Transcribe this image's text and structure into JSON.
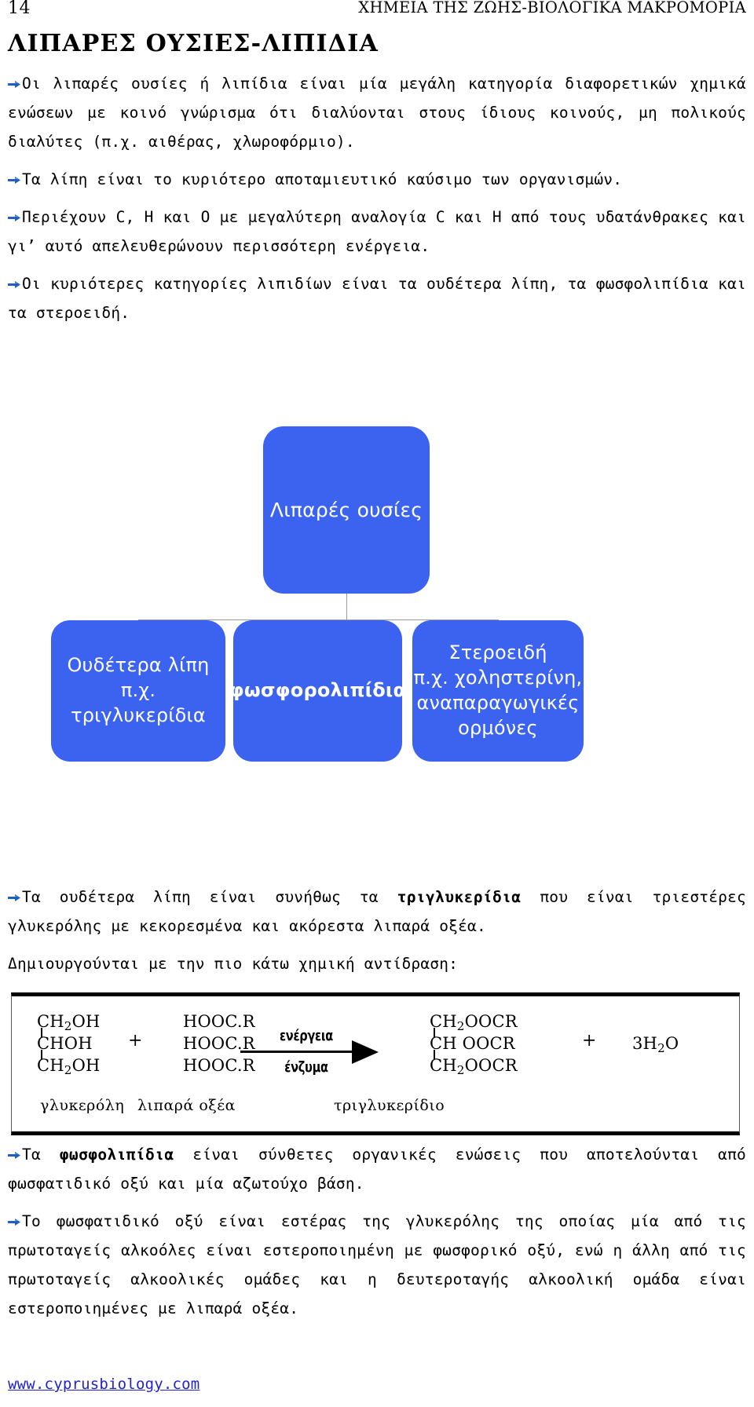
{
  "header": {
    "page_number": "14",
    "running_title": "ΧΗΜΕΙΑ ΤΗΣ ΖΩΗΣ-ΒΙΟΛΟΓΙΚΑ ΜΑΚΡΟΜΟΡΙΑ"
  },
  "title": "ΛΙΠΑΡΕΣ ΟΥΣΙΕΣ-ΛΙΠΙΔΙΑ",
  "bullets_top": [
    {
      "text": "Οι λιπαρές ουσίες ή λιπίδια είναι μία μεγάλη κατηγορία διαφορετικών χημικά ενώσεων με κοινό γνώρισμα ότι διαλύονται στους ίδιους κοινούς, μη πολικούς διαλύτες (π.χ. αιθέρας, χλωροφόρμιο)."
    },
    {
      "text": "Τα λίπη είναι το κυριότερο αποταμιευτικό καύσιμο των οργανισμών."
    },
    {
      "text": "Περιέχουν C, Η και Ο με μεγαλύτερη αναλογία C και Η από τους υδατάνθρακες και γι’ αυτό απελευθερώνουν περισσότερη ενέργεια."
    },
    {
      "text": "Οι κυριότερες κατηγορίες λιπιδίων είναι τα ουδέτερα λίπη, τα φωσφολιπίδια και τα στεροειδή."
    }
  ],
  "flowchart": {
    "accent_color": "#3b63f0",
    "connector_color": "#9a9a9a",
    "root": {
      "label": "Λιπαρές ουσίες"
    },
    "children": [
      {
        "label_line1": "Ουδέτερα λίπη",
        "label_line2": "π.χ. τριγλυκερίδια"
      },
      {
        "label_line1": "φωσφορολιπίδια"
      },
      {
        "label_line1": "Στεροειδή",
        "label_line2": "π.χ. χοληστερίνη,",
        "label_line3": "αναπαραγωγικές",
        "label_line4": "ορμόνες"
      }
    ]
  },
  "bullets_mid": [
    {
      "pre": "Τα ουδέτερα λίπη είναι συνήθως τα ",
      "bold": "τριγλυκερίδια",
      "post": " που είναι τριεστέρες γλυκερόλης με κεκορεσμένα και ακόρεστα λιπαρά οξέα."
    }
  ],
  "intro_reaction": "Δημιουργούνται με την πιο κάτω χημική αντίδραση:",
  "reaction": {
    "reactant1": {
      "line1": "CH",
      "line1_sub": "2",
      "line1_rest": "OH",
      "line2": "CHOH",
      "line3": "CH",
      "line3_sub": "2",
      "line3_rest": "OH",
      "caption": "γλυκερόλη"
    },
    "plus1": "+",
    "reactant2": {
      "line1": "HOOC.R",
      "line2": "HOOC.R",
      "line3": "HOOC.R",
      "caption": "λιπαρά οξέα"
    },
    "arrow": {
      "above": "ενέργεια",
      "below": "ένζυμα"
    },
    "product1": {
      "line1": "CH",
      "line1_sub": "2",
      "line1_rest": "OOCR",
      "line2": "CH OOCR",
      "line3": "CH",
      "line3_sub": "2",
      "line3_rest": "OOCR",
      "caption": "τριγλυκερίδιο"
    },
    "plus2": "+",
    "product2": {
      "prefix": "3H",
      "sub": "2",
      "suffix": "O"
    }
  },
  "bullets_bottom": [
    {
      "pre": "Τα ",
      "bold": "φωσφολιπίδια",
      "post": " είναι σύνθετες οργανικές ενώσεις που αποτελούνται από φωσφατιδικό οξύ και μία αζωτούχο βάση."
    },
    {
      "pre": "",
      "bold": "",
      "post": "Το φωσφατιδικό οξύ είναι εστέρας της γλυκερόλης της οποίας μία από τις πρωτοταγείς αλκοόλες είναι εστεροποιημένη με φωσφορικό οξύ, ενώ η άλλη από τις πρωτοταγείς αλκοολικές ομάδες και η δευτεροταγής αλκοολική ομάδα είναι εστεροποιημένες με λιπαρά οξέα."
    }
  ],
  "footer": {
    "link_text": "www.cyprusbiology.com",
    "link_color": "#2222cc"
  }
}
